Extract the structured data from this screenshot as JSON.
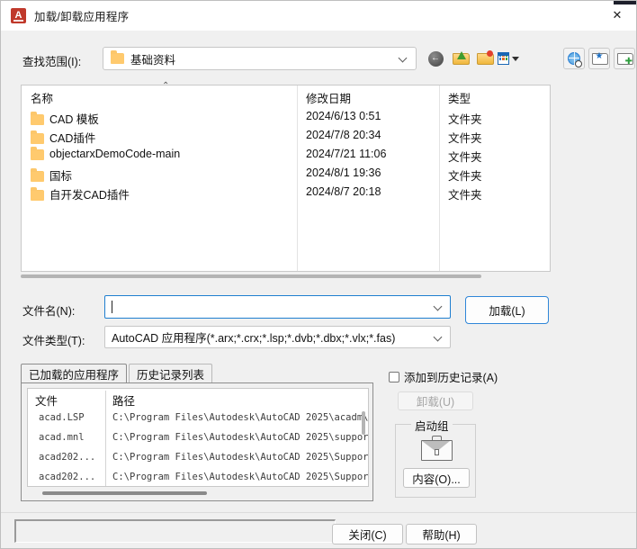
{
  "window": {
    "title": "加载/卸载应用程序",
    "app_icon": "autocad-icon",
    "close_icon": "✕"
  },
  "lookin": {
    "label": "查找范围(I):",
    "value": "基础资料",
    "folder_icon": "folder-icon"
  },
  "toolbar": {
    "back": "back-icon",
    "up": "up-folder-icon",
    "new_folder": "new-folder-icon",
    "views": "views-icon",
    "views_caret": "chevron-down-icon",
    "web_search": "globe-search-icon",
    "favorites": "favorites-folder-icon",
    "add_favorite": "add-favorite-folder-icon"
  },
  "filelist": {
    "sort_indicator": "⌃",
    "columns": [
      "名称",
      "修改日期",
      "类型"
    ],
    "rows": [
      {
        "name": "CAD 模板",
        "date": "2024/6/13 0:51",
        "type": "文件夹"
      },
      {
        "name": "CAD插件",
        "date": "2024/7/8 20:34",
        "type": "文件夹"
      },
      {
        "name": "objectarxDemoCode-main",
        "date": "2024/7/21 11:06",
        "type": "文件夹"
      },
      {
        "name": "国标",
        "date": "2024/8/1 19:36",
        "type": "文件夹"
      },
      {
        "name": "自开发CAD插件",
        "date": "2024/8/7 20:18",
        "type": "文件夹"
      }
    ]
  },
  "filename": {
    "label": "文件名(N):",
    "value": "",
    "caret_icon": "chevron-down-icon"
  },
  "filetype": {
    "label": "文件类型(T):",
    "value": "AutoCAD 应用程序(*.arx;*.crx;*.lsp;*.dvb;*.dbx;*.vlx;*.fas)",
    "caret_icon": "chevron-down-icon"
  },
  "buttons": {
    "load": "加载(L)",
    "unload": "卸载(U)",
    "contents": "内容(O)...",
    "close": "关闭(C)",
    "help": "帮助(H)"
  },
  "tabs": [
    {
      "label": "已加载的应用程序",
      "active": true
    },
    {
      "label": "历史记录列表",
      "active": false
    }
  ],
  "loaded_list": {
    "columns": [
      "文件",
      "路径"
    ],
    "rows": [
      {
        "file": "acad.LSP",
        "path": "C:\\Program Files\\Autodesk\\AutoCAD 2025\\acadm\\"
      },
      {
        "file": "acad.mnl",
        "path": "C:\\Program Files\\Autodesk\\AutoCAD 2025\\suppor"
      },
      {
        "file": "acad202...",
        "path": "C:\\Program Files\\Autodesk\\AutoCAD 2025\\Suppor"
      },
      {
        "file": "acad202...",
        "path": "C:\\Program Files\\Autodesk\\AutoCAD 2025\\Suppor"
      }
    ]
  },
  "history_checkbox": {
    "label": "添加到历史记录(A)",
    "checked": false
  },
  "startup_group": {
    "legend": "启动组",
    "icon": "briefcase-icon"
  },
  "statusbar": {
    "text": ""
  },
  "colors": {
    "accent": "#2f86d8",
    "dialog_bg": "#f0f0f0",
    "title_bg": "#ffffff",
    "folder": "#fcc76b"
  }
}
